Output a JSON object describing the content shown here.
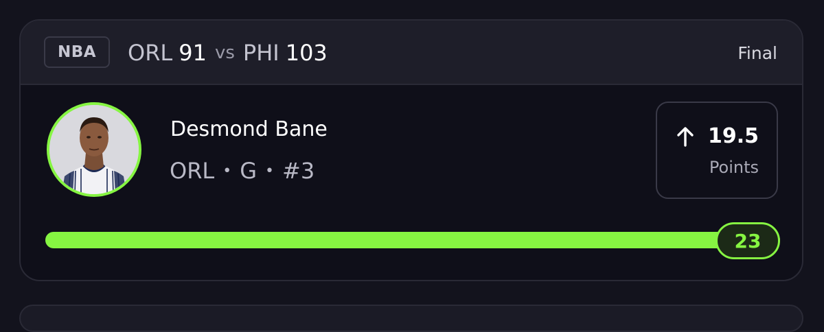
{
  "header": {
    "league": "NBA",
    "away_team": "ORL",
    "away_score": "91",
    "vs_label": "vs",
    "home_team": "PHI",
    "home_score": "103",
    "status": "Final"
  },
  "player": {
    "name": "Desmond Bane",
    "team": "ORL",
    "position": "G",
    "number": "#3",
    "separator": "•",
    "avatar_icon": "player-headshot"
  },
  "projection": {
    "direction": "over",
    "direction_icon": "arrow-up-icon",
    "line": "19.5",
    "stat": "Points"
  },
  "result": {
    "actual": "23",
    "progress_fraction": 1.0
  },
  "colors": {
    "accent": "#86f542",
    "background": "#13131d",
    "card": "#0f0f19",
    "header": "#1e1e29"
  }
}
